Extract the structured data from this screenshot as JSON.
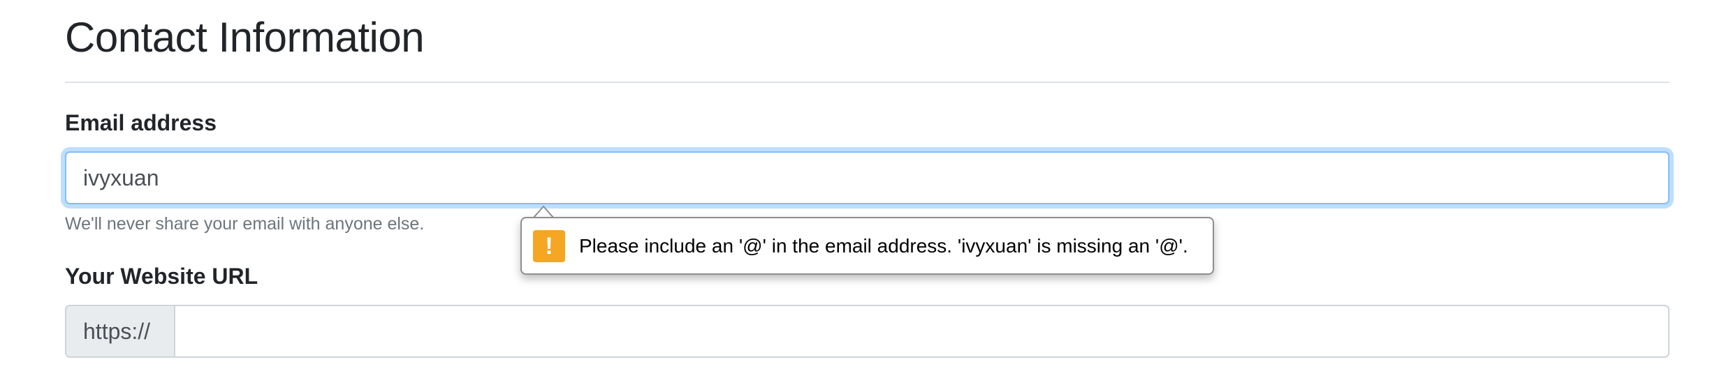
{
  "page": {
    "title": "Contact Information"
  },
  "email": {
    "label": "Email address",
    "value": "ivyxuan",
    "help": "We'll never share your email with anyone else."
  },
  "website": {
    "label": "Your Website URL",
    "prefix": "https://",
    "value": ""
  },
  "validation_tooltip": {
    "icon": "warning-icon",
    "icon_glyph": "!",
    "message": "Please include an '@' in the email address. 'ivyxuan' is missing an '@'."
  },
  "colors": {
    "focus_border": "#80bdff",
    "warning_icon": "#f5a623",
    "help_text": "#6c757d"
  }
}
